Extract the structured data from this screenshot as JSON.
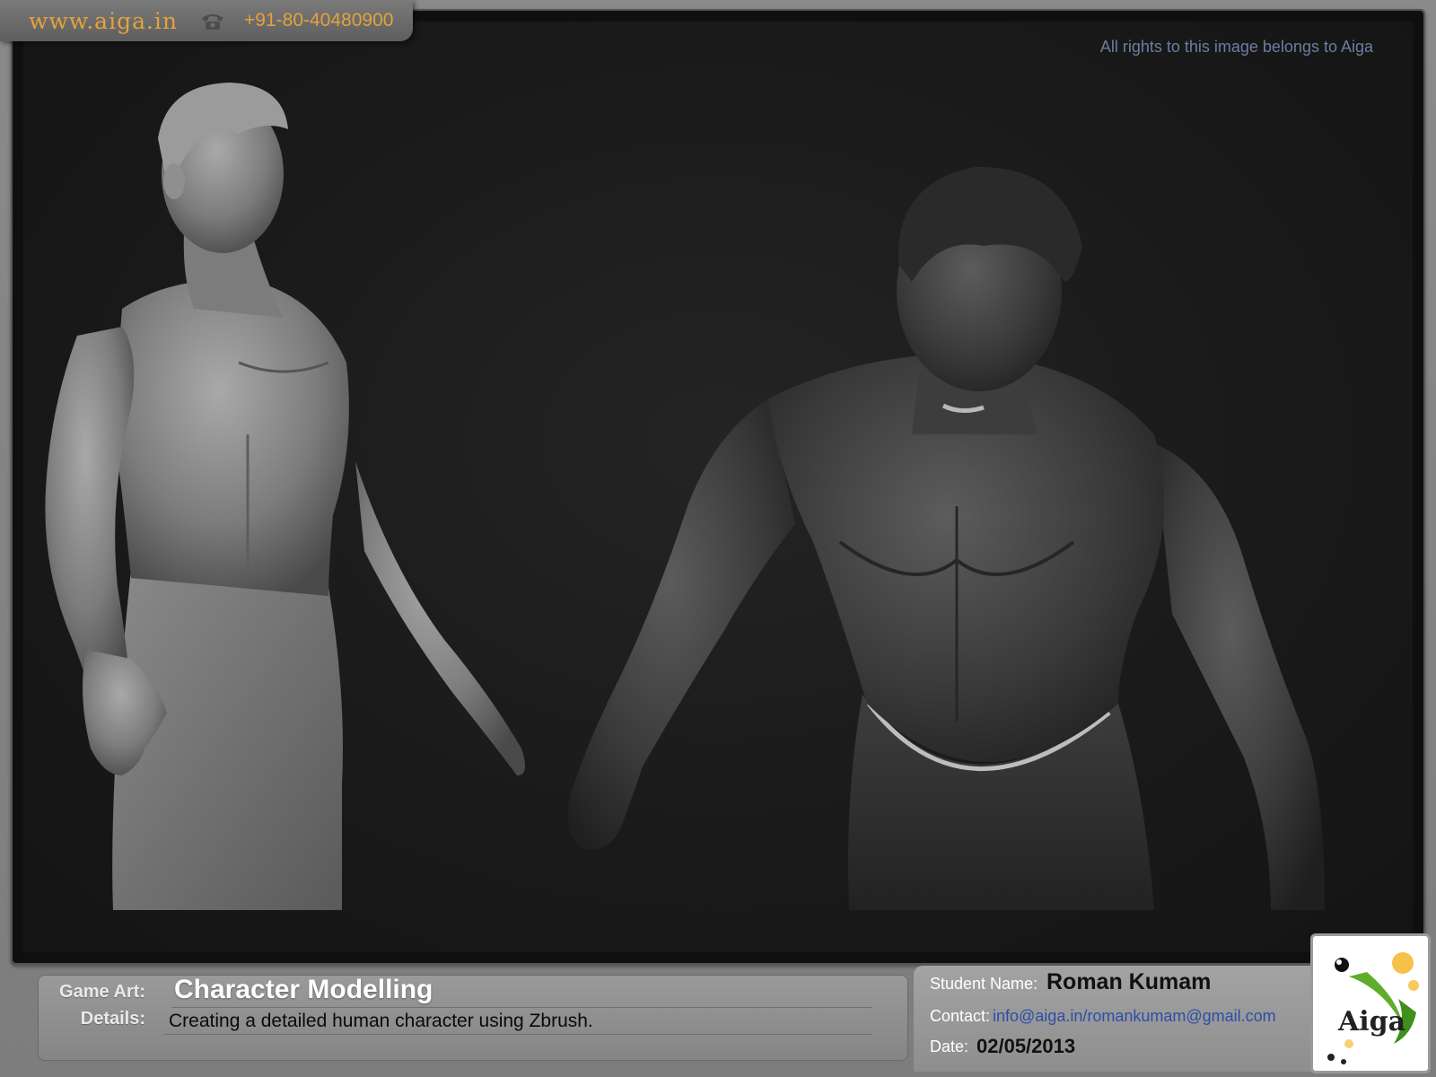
{
  "header": {
    "site_url": "www.aiga.in",
    "phone": "+91-80-40480900",
    "phone_icon": "phone-icon"
  },
  "viewport": {
    "rights_note": "All rights to this image belongs to Aiga"
  },
  "info": {
    "game_art_label": "Game Art:",
    "title": "Character Modelling",
    "details_label": "Details:",
    "details": "Creating a detailed human character using Zbrush.",
    "student_label": "Student Name:",
    "student_name": "Roman Kumam",
    "contact_label": "Contact:",
    "contact_value": "info@aiga.in/romankumam@gmail.com",
    "date_label": "Date:",
    "date": "02/05/2013"
  },
  "logo": {
    "text": "Aiga"
  },
  "colors": {
    "accent_orange": "#e4a23a",
    "link_blue": "#2c4ea8",
    "rights_blue": "#6a7ea3"
  }
}
